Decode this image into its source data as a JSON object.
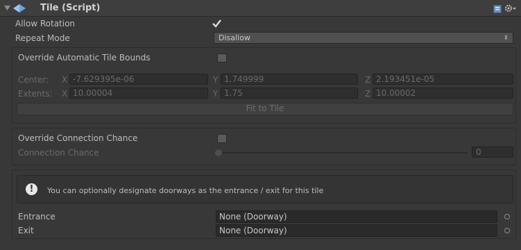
{
  "component": {
    "title": "Tile (Script)",
    "icons": {
      "foldout": "triangle-down-icon",
      "script": "diamond-script-icon",
      "help": "book-help-icon",
      "settings": "gear-icon"
    }
  },
  "allow_rotation": {
    "label": "Allow Rotation",
    "checked": true
  },
  "repeat_mode": {
    "label": "Repeat Mode",
    "value": "Disallow"
  },
  "bounds": {
    "override_label": "Override Automatic Tile Bounds",
    "override_checked": false,
    "center_label": "Center:",
    "extents_label": "Extents:",
    "axis_x": "X",
    "axis_y": "Y",
    "axis_z": "Z",
    "center": {
      "x": "-7.629395e-06",
      "y": "1.749999",
      "z": "2.193451e-05"
    },
    "extents": {
      "x": "10.00004",
      "y": "1.75",
      "z": "10.00002"
    },
    "fit_button": "Fit to Tile"
  },
  "connection": {
    "override_label": "Override Connection Chance",
    "override_checked": false,
    "chance_label": "Connection Chance",
    "chance_value": "0"
  },
  "doorways": {
    "help_text": "You can optionally designate doorways as the entrance / exit for this tile",
    "help_icon": "exclamation-icon",
    "entrance_label": "Entrance",
    "entrance_value": "None (Doorway)",
    "exit_label": "Exit",
    "exit_value": "None (Doorway)"
  }
}
